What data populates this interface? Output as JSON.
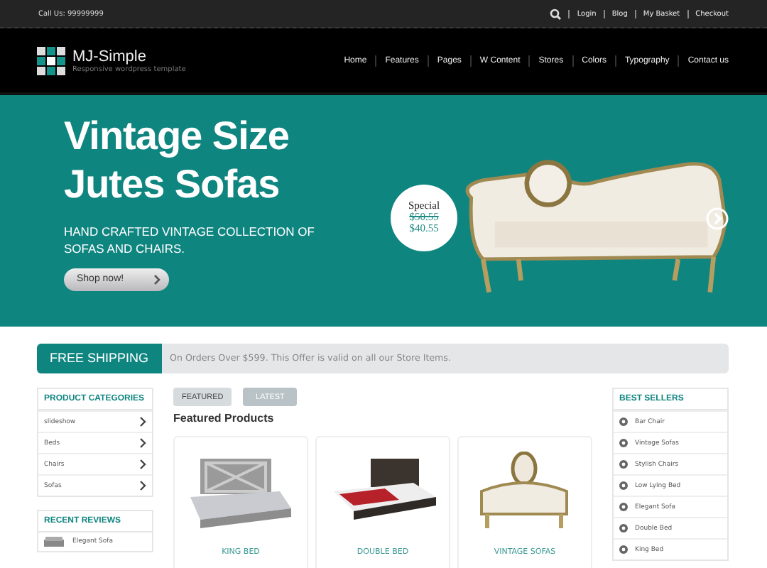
{
  "topbar": {
    "phone": "Call Us: 99999999",
    "links": [
      "Login",
      "Blog",
      "My Basket",
      "Checkout"
    ]
  },
  "header": {
    "logo": "MJ-Simple",
    "tagline": "Responsive wordpress template",
    "nav": [
      "Home",
      "Features",
      "Pages",
      "W Content",
      "Stores",
      "Colors",
      "Typography",
      "Contact us"
    ]
  },
  "hero": {
    "title_lines": [
      "Vintage Size",
      "Jutes Sofas"
    ],
    "subtitle": "HAND CRAFTED VINTAGE COLLECTION OF SOFAS AND CHAIRS.",
    "button": "Shop now!",
    "badge": {
      "label": "Special",
      "old_price": "$50.55",
      "price": "$40.55"
    }
  },
  "shipping": {
    "label": "FREE SHIPPING",
    "text": "On Orders Over $599. This Offer is valid on all our Store Items."
  },
  "categories": {
    "title": "PRODUCT CATEGORIES",
    "items": [
      "slideshow",
      "Beds",
      "Chairs",
      "Sofas"
    ]
  },
  "reviews": {
    "title": "RECENT REVIEWS",
    "items": [
      "Elegant Sofa"
    ]
  },
  "tabs": [
    {
      "label": "FEATURED",
      "selected": true
    },
    {
      "label": "LATEST",
      "selected": false
    }
  ],
  "products_title": "Featured Products",
  "products": [
    {
      "name": "KING BED",
      "kind": "bed"
    },
    {
      "name": "DOUBLE BED",
      "kind": "lowbed"
    },
    {
      "name": "VINTAGE SOFAS",
      "kind": "sofa"
    }
  ],
  "best_sellers": {
    "title": "BEST SELLERS",
    "items": [
      "Bar Chair",
      "Vintage Sofas",
      "Stylish Chairs",
      "Low Lying Bed",
      "Elegant Sofa",
      "Double Bed",
      "King Bed"
    ]
  }
}
